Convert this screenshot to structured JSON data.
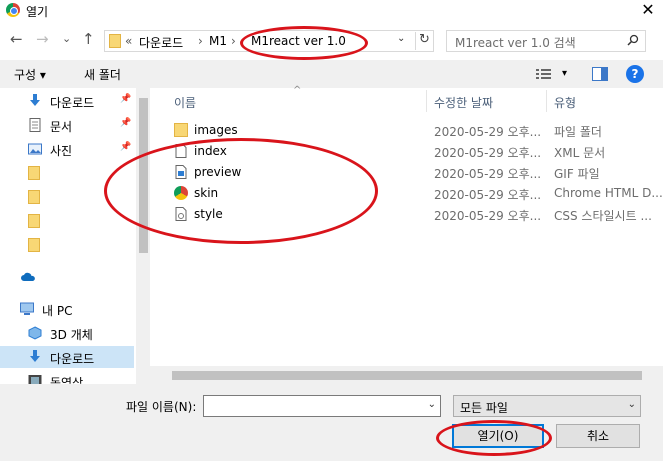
{
  "window": {
    "title": "열기",
    "close_glyph": "✕"
  },
  "nav": {
    "back": "←",
    "forward": "→",
    "recent": "⌄",
    "up": "↑"
  },
  "address": {
    "overflow": "«",
    "crumbs": [
      "다운로드",
      "M1",
      "M1react ver 1.0"
    ],
    "separator": "›",
    "dropdown": "⌄",
    "refresh": "↻"
  },
  "search": {
    "placeholder": "M1react ver 1.0 검색"
  },
  "toolbar": {
    "organize": "구성 ▾",
    "new_folder": "새 폴더",
    "view_dd": "▾",
    "help": "?"
  },
  "sidebar": {
    "items": [
      {
        "label": "다운로드",
        "icon": "download-icon",
        "pinned": true
      },
      {
        "label": "문서",
        "icon": "document-icon",
        "pinned": true
      },
      {
        "label": "사진",
        "icon": "pictures-icon",
        "pinned": true
      },
      {
        "label": "",
        "icon": "folder-icon"
      },
      {
        "label": "",
        "icon": "folder-icon"
      },
      {
        "label": "",
        "icon": "folder-icon"
      },
      {
        "label": "",
        "icon": "folder-icon"
      },
      {
        "label": "",
        "icon": "onedrive-icon"
      },
      {
        "label": "내 PC",
        "icon": "pc-icon"
      },
      {
        "label": "3D 개체",
        "icon": "3d-objects-icon"
      },
      {
        "label": "다운로드",
        "icon": "download-icon",
        "selected": true
      },
      {
        "label": "동영상",
        "icon": "video-icon"
      }
    ]
  },
  "columns": {
    "name": "이름",
    "modified": "수정한 날짜",
    "type": "유형",
    "sort": "^"
  },
  "files": [
    {
      "name": "images",
      "date": "2020-05-29 오후...",
      "type": "파일 폴더",
      "icon": "folder-icon"
    },
    {
      "name": "index",
      "date": "2020-05-29 오후...",
      "type": "XML 문서",
      "icon": "xml-file-icon"
    },
    {
      "name": "preview",
      "date": "2020-05-29 오후...",
      "type": "GIF 파일",
      "icon": "image-file-icon"
    },
    {
      "name": "skin",
      "date": "2020-05-29 오후...",
      "type": "Chrome HTML D...",
      "icon": "chrome-icon"
    },
    {
      "name": "style",
      "date": "2020-05-29 오후...",
      "type": "CSS 스타일시트 ...",
      "icon": "css-file-icon"
    }
  ],
  "footer": {
    "filename_label": "파일 이름(N):",
    "filename_value": "",
    "filter_value": "모든 파일",
    "dropdown": "⌄",
    "open_button": "열기(O)",
    "cancel_button": "취소"
  },
  "colors": {
    "accent": "#0078d7",
    "annotation": "#d9141b",
    "selection": "#cce4f7",
    "folder": "#f8d775"
  }
}
